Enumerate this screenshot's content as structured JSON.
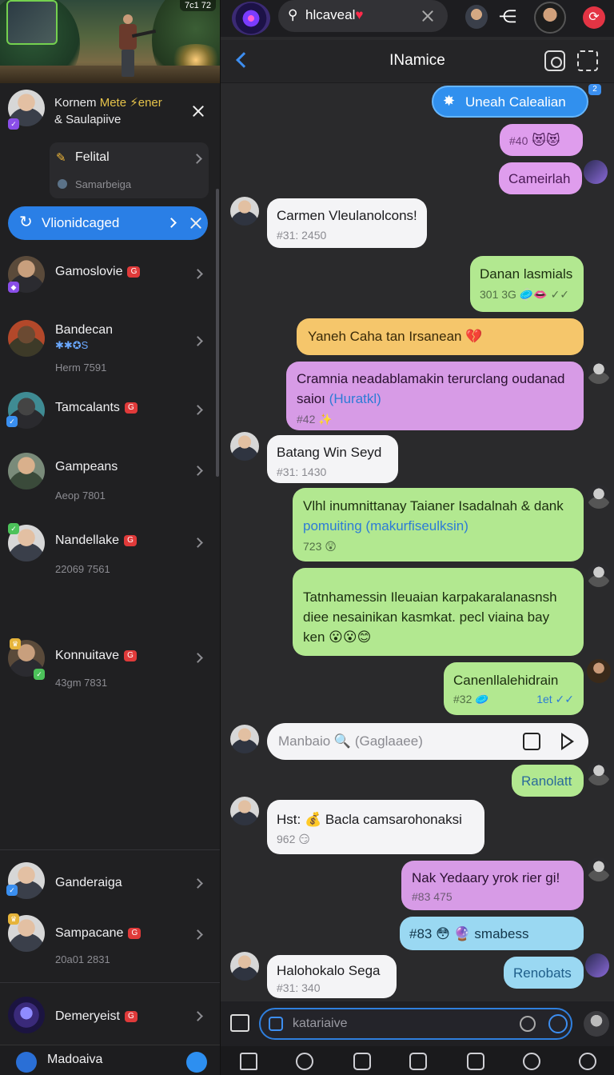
{
  "banner": {
    "status_text": "7c1 72"
  },
  "notification": {
    "line1": "Kornem",
    "line1_accent": "Mete ⚡ener",
    "line2": "& Saulapiive"
  },
  "pinned": {
    "title": "Felital",
    "subtitle": "Samarbeiga"
  },
  "pill": {
    "label": "Vlionidcaged"
  },
  "chats": [
    {
      "name": "Gamoslovie",
      "sub": ""
    },
    {
      "name": "Bandecan",
      "sub": "Herm 7591",
      "tag": "✱✱✪S"
    },
    {
      "name": "Tamcalants",
      "sub": ""
    },
    {
      "name": "Gampeans",
      "sub": "Aeop 7801"
    },
    {
      "name": "Nandellake",
      "sub": "22069 7561"
    },
    {
      "name": "Konnuitave",
      "sub": "43gm 7831"
    },
    {
      "name": "Ganderaiga",
      "sub": ""
    },
    {
      "name": "Sampacane",
      "sub": "20a01 2831"
    },
    {
      "name": "Demeryeist",
      "sub": ""
    }
  ],
  "left_footer": {
    "name": "Madoaiva"
  },
  "topbar": {
    "search_value": "hlcaveal",
    "search_heart": "♥"
  },
  "header": {
    "title": "INamice"
  },
  "unread": {
    "label": "Uneah Calealian",
    "count": "2"
  },
  "messages": {
    "m1": {
      "meta": "#40",
      "emoji": "😻😻"
    },
    "m2": {
      "body": "Cameirlah"
    },
    "m3": {
      "body": "Carmen Vleulanolcons!",
      "meta": "#31: 2450"
    },
    "m4": {
      "body": "Danan lasmials",
      "meta": "301 3G 🥏👄 ✓✓"
    },
    "m5": {
      "body": "Yaneh Caha tan Irsanean 💔"
    },
    "m6": {
      "body": "Cramnia neadablamakin terurclang oudanad saioı",
      "link": "(Huratkl)",
      "meta": "#42 ✨"
    },
    "m7": {
      "body": "Batang Win Seyd",
      "meta": "#31: 1430"
    },
    "m8": {
      "body": "Vlhl inumnittanay Taianer Isadalnah & dank",
      "link": "pomuiting (makurfiseulksin)",
      "meta": "723 😲"
    },
    "m9": {
      "body": "Tatnhamessin Ileuaian karpakaralanasnsh diee nesainikan kasmkat. pecl viaina bay ken 😮😮😊"
    },
    "m10": {
      "body": "Canenllalehidrain",
      "meta": "#32 🥏",
      "meta_right": "1et ✓✓"
    },
    "m11": {
      "body": "Ranolatt"
    },
    "m12": {
      "body": "Hst: 💰 Bacla camsarohonaksi",
      "meta": "962 😏"
    },
    "m13": {
      "body": "Nak Yedaary yrok rier gi!",
      "meta": "#83 475"
    },
    "m14": {
      "body": "#83 😳 🔮  smabess"
    },
    "m15": {
      "body": "Halohokalo Sega",
      "meta": "#31: 340"
    },
    "m16": {
      "body": "Renobats"
    }
  },
  "composer": {
    "placeholder": "Manbaio 🔍 (Gaglaaee)"
  },
  "inputbar": {
    "placeholder": "katariaive"
  },
  "colors": {
    "accent": "#2a7fe6",
    "badge_red": "#e03a3a",
    "bubble_green": "#b2e890",
    "bubble_pink": "#df9ded"
  },
  "icons": [
    "search-icon",
    "close-icon",
    "share-icon",
    "record-icon",
    "back-icon",
    "camera-icon",
    "more-icon",
    "send-icon",
    "attach-icon",
    "emoji-icon",
    "home-icon"
  ]
}
